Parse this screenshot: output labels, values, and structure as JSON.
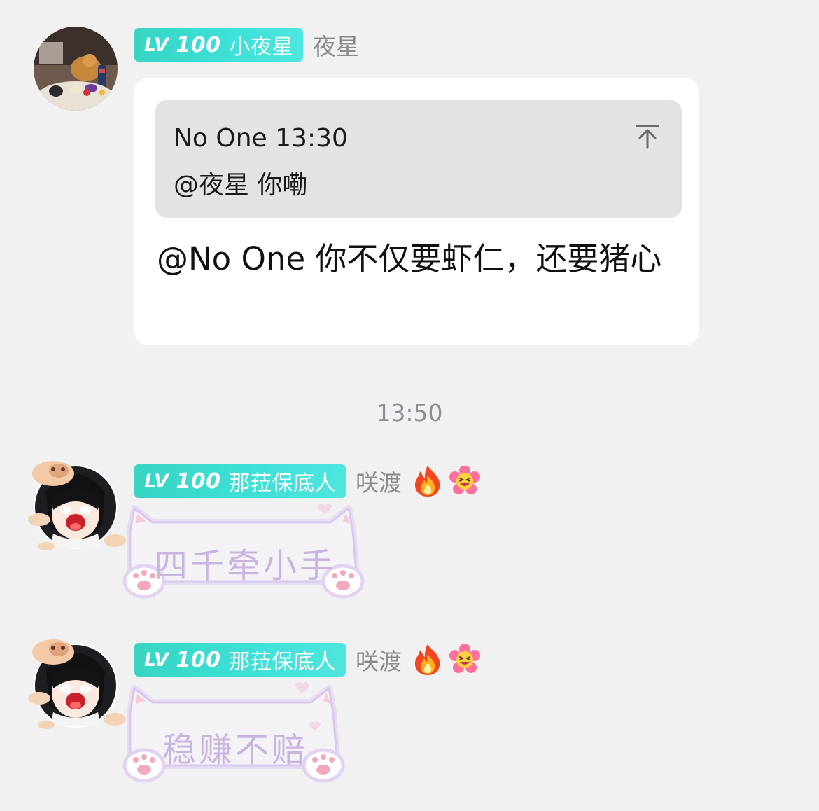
{
  "messages": [
    {
      "badge": {
        "level_prefix": "LV",
        "level": "100",
        "title": "小夜星"
      },
      "nickname": "夜星",
      "quote": {
        "header": "No One 13:30",
        "text": "@夜星 你嘞",
        "jump_icon": "jump-to-original-icon"
      },
      "text": "@No One 你不仅要虾仁，还要猪心"
    },
    {
      "badge": {
        "level_prefix": "LV",
        "level": "100",
        "title": "那菈保底人"
      },
      "nickname": "咲渡",
      "flair_icons": [
        "fire-icon",
        "laughing-flower-icon"
      ],
      "sticker_text": "四千牵小手"
    },
    {
      "badge": {
        "level_prefix": "LV",
        "level": "100",
        "title": "那菈保底人"
      },
      "nickname": "咲渡",
      "flair_icons": [
        "fire-icon",
        "laughing-flower-icon"
      ],
      "sticker_text": "稳赚不赔"
    }
  ],
  "timestamp": "13:50",
  "colors": {
    "background": "#f1f1f1",
    "badge": "#3fe1d8",
    "bubble": "#ffffff",
    "quote": "#e3e3e3",
    "nickname": "#8a8a8a",
    "sticker_text": "#c9b4e0"
  }
}
